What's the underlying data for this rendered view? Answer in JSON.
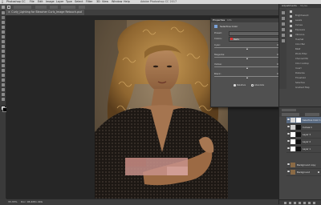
{
  "app": {
    "menu": [
      "Photoshop CC",
      "File",
      "Edit",
      "Image",
      "Layer",
      "Type",
      "Select",
      "Filter",
      "3D",
      "View",
      "Window",
      "Help"
    ],
    "window_title": "Adobe Photoshop CC 2017"
  },
  "document": {
    "tab_label": "Curly_Lighting for Bleacher Curls_Image Retouch.psd",
    "status_zoom": "33.33%",
    "status_doc": "Doc: 96.4M/1.49G"
  },
  "properties_panel": {
    "tabs": [
      "Properties",
      "Info"
    ],
    "title": "Selective Color",
    "preset_label": "Preset:",
    "colors_label": "Colors:",
    "colors_value": "Reds",
    "sliders": [
      {
        "label": "Cyan:",
        "value": 0
      },
      {
        "label": "Magenta:",
        "value": 0
      },
      {
        "label": "Yellow:",
        "value": 0
      },
      {
        "label": "Black:",
        "value": 0
      }
    ],
    "method_relative": "Relative",
    "method_absolute": "Absolute"
  },
  "right_dock": {
    "tabs": [
      "Adjustments",
      "Styles"
    ],
    "adjustments": [
      "Brightness/C",
      "Levels",
      "Curves",
      "Exposure",
      "Vibrance",
      "Hue/Sat",
      "Color Bal",
      "B&W",
      "Photo Filter",
      "Channel Mix",
      "Color Lookup",
      "Invert",
      "Posterize",
      "Threshold",
      "Selective",
      "Gradient Map"
    ]
  },
  "layers": [
    {
      "name": "Selective Color 1",
      "active": true
    },
    {
      "name": "Curves 1",
      "active": false
    },
    {
      "name": "Layer 3",
      "active": false
    },
    {
      "name": "Layer 2",
      "active": false
    },
    {
      "name": "Layer 1",
      "active": false
    },
    {
      "name": "Background copy",
      "active": false
    },
    {
      "name": "Background",
      "active": false
    }
  ],
  "colors": {
    "accent": "#2d5f9e",
    "ps_dark": "#262626",
    "panel": "#505050"
  }
}
